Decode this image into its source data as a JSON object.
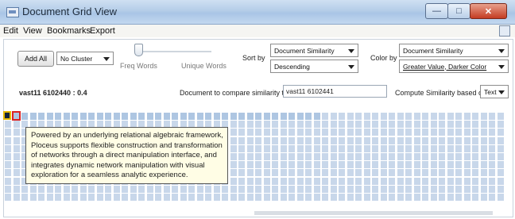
{
  "window": {
    "title": "Document Grid View"
  },
  "menu": [
    "Edit",
    "View",
    "Bookmarks",
    "Export"
  ],
  "toolbar": {
    "add_all": "Add All",
    "cluster_select": "No Cluster",
    "freq_words": "Freq Words",
    "unique_words": "Unique Words",
    "sort_by_label": "Sort by",
    "sort_metric": "Document Similarity",
    "sort_order": "Descending",
    "color_by_label": "Color by",
    "color_metric": "Document Similarity",
    "color_order": "Greater Value, Darker Color"
  },
  "info": {
    "current_doc": "vast11  6102440 : 0.4",
    "compare_label": "Document to compare similarity to",
    "compare_value": "vast11  6102441",
    "compute_label": "Compute Similarity based on",
    "compute_value": "Text"
  },
  "tooltip": {
    "lines": [
      "Powered by an underlying relational algebraic framework,",
      "Ploceus supports flexible construction and transformation",
      "of networks through a direct manipulation interface, and",
      "integrates dynamic network manipulation with visual",
      "exploration for a seamless analytic experience."
    ]
  },
  "colors": {
    "cell": "#c8d7ea",
    "cell_dark": "#aec6e2",
    "selected_border": "#e6b800",
    "compare_border": "#d22222"
  }
}
